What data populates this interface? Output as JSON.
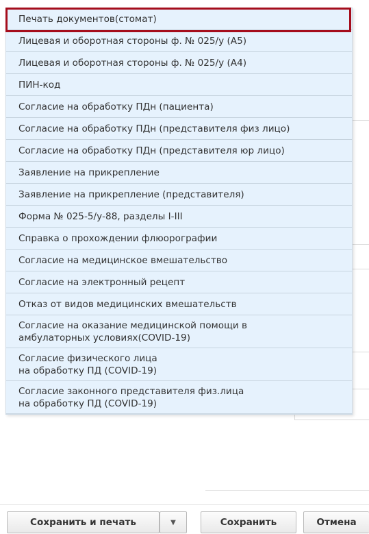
{
  "menu": {
    "items": [
      {
        "label": "Печать документов(стомат)"
      },
      {
        "label": "Лицевая и оборотная стороны ф. № 025/у (А5)"
      },
      {
        "label": "Лицевая и оборотная стороны ф. № 025/у (А4)"
      },
      {
        "label": "ПИН-код"
      },
      {
        "label": "Согласие на обработку ПДн (пациента)"
      },
      {
        "label": "Согласие на обработку ПДн (представителя физ лицо)"
      },
      {
        "label": "Согласие на обработку ПДн (представителя юр лицо)"
      },
      {
        "label": "Заявление на прикрепление"
      },
      {
        "label": "Заявление на прикрепление (представителя)"
      },
      {
        "label": "Форма № 025-5/у-88, разделы I-III"
      },
      {
        "label": "Справка о прохождении флюорографии"
      },
      {
        "label": "Согласие на медицинское вмешательство"
      },
      {
        "label": "Согласие на электронный рецепт"
      },
      {
        "label": "Отказ от видов медицинских вмешательств"
      },
      {
        "label": "Согласие на оказание медицинской помощи в\nамбулаторных условиях(COVID-19)"
      },
      {
        "label": "Согласие физического лица\nна обработку ПД (COVID-19)"
      },
      {
        "label": "Согласие законного представителя физ.лица\nна обработку ПД (COVID-19)"
      }
    ]
  },
  "footer": {
    "save_print_label": "Сохранить и печать",
    "dropdown_icon": "caret-down-icon",
    "save_label": "Сохранить",
    "cancel_label": "Отмена"
  },
  "colors": {
    "menu_item_bg": "#e6f2fd",
    "highlight_border": "#a50d1c"
  }
}
